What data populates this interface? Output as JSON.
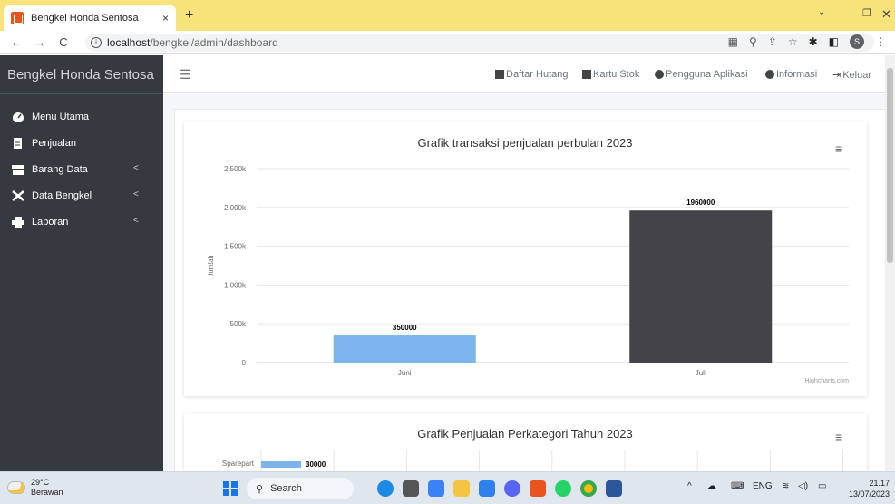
{
  "browser": {
    "tab_title": "Bengkel Honda Sentosa",
    "tab_close": "×",
    "new_tab": "+",
    "url_host": "localhost",
    "url_path": "/bengkel/admin/dashboard",
    "profile_initial": "S"
  },
  "sidebar": {
    "brand": "Bengkel Honda Sentosa",
    "items": [
      {
        "label": "Menu Utama",
        "icon": "dashboard-icon",
        "has_arrow": false
      },
      {
        "label": "Penjualan",
        "icon": "file-icon",
        "has_arrow": false
      },
      {
        "label": "Barang Data",
        "icon": "box-icon",
        "has_arrow": true
      },
      {
        "label": "Data Bengkel",
        "icon": "tools-icon",
        "has_arrow": true
      },
      {
        "label": "Laporan",
        "icon": "print-icon",
        "has_arrow": true
      }
    ],
    "arrow": "<"
  },
  "topnav": {
    "links": [
      "Daftar Hutang",
      "Kartu Stok",
      "Pengguna Aplikasi",
      "Informasi",
      "Keluar"
    ]
  },
  "chart_data": [
    {
      "type": "bar",
      "title": "Grafik transaksi penjualan perbulan 2023",
      "ylabel": "Jumlah",
      "categories": [
        "Juni",
        "Juli"
      ],
      "values": [
        350000,
        1960000
      ],
      "data_labels": [
        "350000",
        "1960000"
      ],
      "colors": [
        "#7cb5ec",
        "#434348"
      ],
      "ylim": [
        0,
        2500000
      ],
      "yticks": [
        "0",
        "500k",
        "1 000k",
        "1 500k",
        "2 000k",
        "2 500k"
      ],
      "credit": "Highcharts.com",
      "grid": true
    },
    {
      "type": "bar",
      "title": "Grafik Penjualan Perkategori Tahun 2023",
      "orientation": "horizontal",
      "categories": [
        "Sparepart"
      ],
      "values": [
        30000
      ],
      "data_labels": [
        "30000"
      ],
      "colors": [
        "#7cb5ec"
      ]
    }
  ],
  "taskbar": {
    "temperature": "29°C",
    "weather": "Berawan",
    "search": "Search",
    "lang": "ENG",
    "time": "21.17",
    "date": "13/07/2023"
  },
  "colors": {
    "sidebar_bg": "#343a40",
    "content_bg": "#f4f6f9",
    "tab_bar": "#f8e27a"
  }
}
